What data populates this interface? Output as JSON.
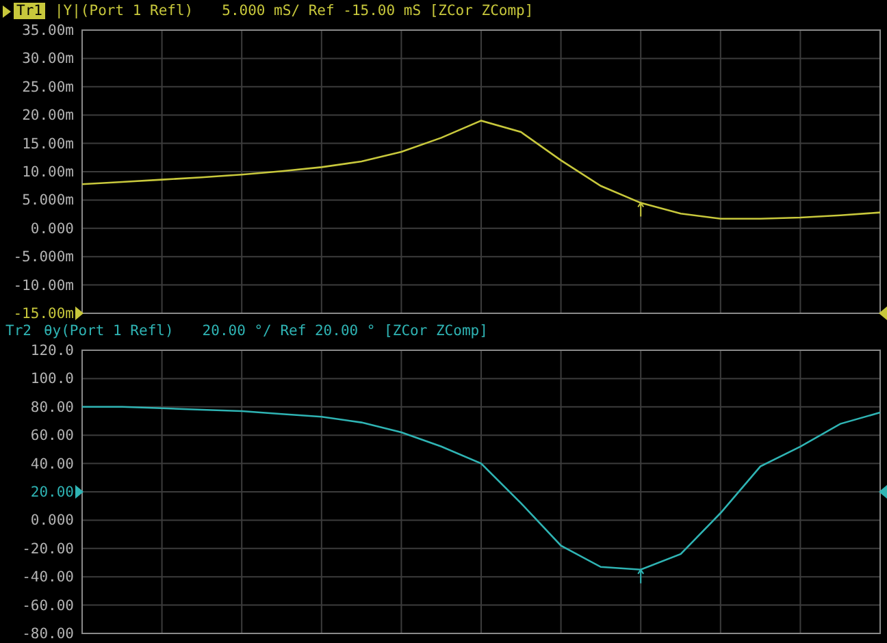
{
  "traces": [
    {
      "active": true,
      "reference": {
        "at_bottom": true,
        "at_middle": false
      },
      "marker": {
        "on": true
      },
      "format": "|Y|(Port 1 Refl)",
      "scale": "5.000 mS/ Ref -15.00 mS [ZCor ZComp]",
      "chart_data": {
        "type": "line",
        "grid": true,
        "ylim": [
          -15,
          35
        ],
        "yticks": [
          {
            "value": 35,
            "label": "35.00m"
          },
          {
            "value": 30,
            "label": "30.00m"
          },
          {
            "value": 25,
            "label": "25.00m"
          },
          {
            "value": 20,
            "label": "20.00m"
          },
          {
            "value": 15,
            "label": "15.00m"
          },
          {
            "value": 10,
            "label": "10.00m"
          },
          {
            "value": 5,
            "label": "5.000m"
          },
          {
            "value": 0,
            "label": "0.000"
          },
          {
            "value": -5,
            "label": "-5.000m"
          },
          {
            "value": -10,
            "label": "-10.00m"
          },
          {
            "value": -15,
            "label": "-15.00m"
          }
        ],
        "series": [
          {
            "name": "Tr1",
            "color": "#c8c83c",
            "values": [
              7.8,
              8.2,
              8.6,
              9.0,
              9.5,
              10.1,
              10.8,
              11.8,
              13.5,
              16.0,
              19.0,
              17.0,
              12.0,
              7.5,
              4.5,
              2.6,
              1.7,
              1.7,
              1.9,
              2.3,
              2.8
            ]
          }
        ]
      }
    },
    {
      "active": false,
      "reference": {
        "at_bottom": false,
        "at_middle": true
      },
      "marker": {
        "on": true
      },
      "format": "θy(Port 1 Refl)",
      "scale": "20.00 °/ Ref 20.00 ° [ZCor ZComp]",
      "chart_data": {
        "type": "line",
        "grid": true,
        "ylim": [
          -80,
          120
        ],
        "yticks": [
          {
            "value": 120,
            "label": "120.0"
          },
          {
            "value": 100,
            "label": "100.0"
          },
          {
            "value": 80,
            "label": "80.00"
          },
          {
            "value": 60,
            "label": "60.00"
          },
          {
            "value": 40,
            "label": "40.00"
          },
          {
            "value": 20,
            "label": "20.00"
          },
          {
            "value": 0,
            "label": "0.000"
          },
          {
            "value": -20,
            "label": "-20.00"
          },
          {
            "value": -40,
            "label": "-40.00"
          },
          {
            "value": -60,
            "label": "-60.00"
          },
          {
            "value": -80,
            "label": "-80.00"
          }
        ],
        "series": [
          {
            "name": "Tr2",
            "color": "#2fb4b4",
            "values": [
              80,
              80,
              79,
              78,
              77,
              75,
              73,
              69,
              62,
              52,
              40,
              12,
              -18,
              -33,
              -35,
              -24,
              5,
              38,
              52,
              68,
              76
            ]
          }
        ]
      }
    }
  ]
}
